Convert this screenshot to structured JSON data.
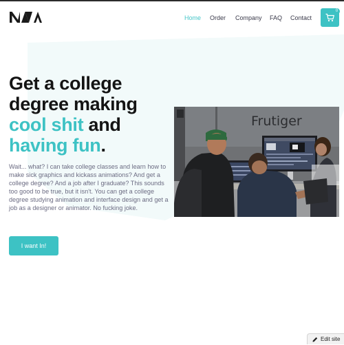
{
  "header": {
    "nav": [
      {
        "label": "Home",
        "active": true
      },
      {
        "label": "Order",
        "active": false
      },
      {
        "label": "Company",
        "active": false
      },
      {
        "label": "FAQ",
        "active": false
      },
      {
        "label": "Contact",
        "active": false
      }
    ],
    "cart_count": "0",
    "cart_icon": "shopping-cart-icon"
  },
  "hero": {
    "line1": "Get a college",
    "line2": "degree making",
    "line3_highlight": "cool shit",
    "line3_rest": " and",
    "line4_highlight": "having fun",
    "line4_rest": ".",
    "body": "Wait... what? I can take college classes and learn how to make sick graphics and kickass animations? And get a college degree? And a job after I graduate? This sounds too good to be true, but it isn't. You can get a college degree studying animation and interface design and get a job as a designer or animator. No fucking joke.",
    "cta_label": "I want In!"
  },
  "photo": {
    "wall_sign": "Frutiger"
  },
  "editor": {
    "label": "Edit site",
    "icon": "pencil-icon"
  },
  "colors": {
    "accent": "#3dc2c4",
    "heading": "#141414",
    "body_text": "#6b6b82",
    "nav_text": "#3a3a4a",
    "background_wash": "#f2fafa"
  }
}
